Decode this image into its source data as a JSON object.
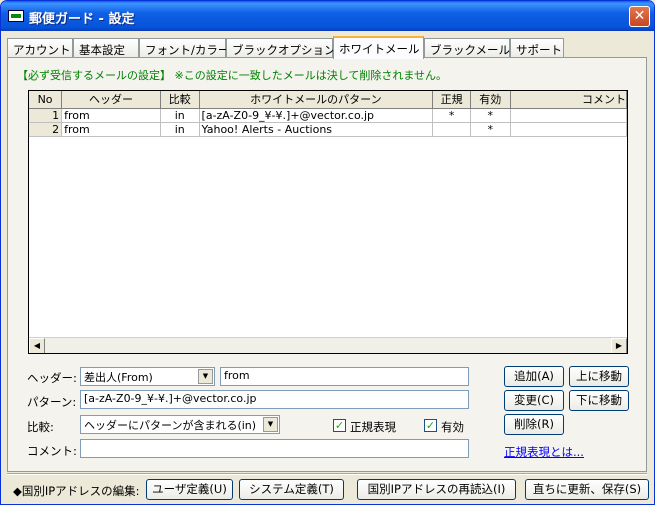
{
  "window": {
    "title": "郵便ガード - 設定",
    "close": "✕"
  },
  "tabs": [
    "アカウント",
    "基本設定",
    "フォント/カラー",
    "ブラックオプション",
    "ホワイトメール",
    "ブラックメール",
    "サポート"
  ],
  "group_label": "【必ず受信するメールの設定】 ※この設定に一致したメールは決して削除されません。",
  "grid": {
    "headers": [
      "No",
      "ヘッダー",
      "比較",
      "ホワイトメールのパターン",
      "正規",
      "有効",
      "コメント"
    ],
    "rows": [
      {
        "no": "1",
        "header": "from",
        "compare": "in",
        "pattern": "[a-zA-Z0-9_¥-¥.]+@vector.co.jp",
        "regex": "*",
        "enabled": "*",
        "comment": ""
      },
      {
        "no": "2",
        "header": "from",
        "compare": "in",
        "pattern": "Yahoo! Alerts - Auctions",
        "regex": "",
        "enabled": "*",
        "comment": ""
      }
    ]
  },
  "form": {
    "header_label": "ヘッダー:",
    "header_select": "差出人(From)",
    "header_value": "from",
    "pattern_label": "パターン:",
    "pattern_value": "[a-zA-Z0-9_¥-¥.]+@vector.co.jp",
    "compare_label": "比較:",
    "compare_select": "ヘッダーにパターンが含まれる(in)",
    "regex_label": "正規表現",
    "enabled_label": "有効",
    "comment_label": "コメント:",
    "comment_value": ""
  },
  "buttons": {
    "add": "追加(A)",
    "move_up": "上に移動",
    "change": "変更(C)",
    "move_down": "下に移動",
    "delete": "削除(R)",
    "regex_help": "正規表現とは..."
  },
  "bottom": {
    "label": "◆国別IPアドレスの編集:",
    "user_def": "ユーザ定義(U)",
    "system_def": "システム定義(T)",
    "reload": "国別IPアドレスの再読込(I)",
    "save": "直ちに更新、保存(S)"
  }
}
